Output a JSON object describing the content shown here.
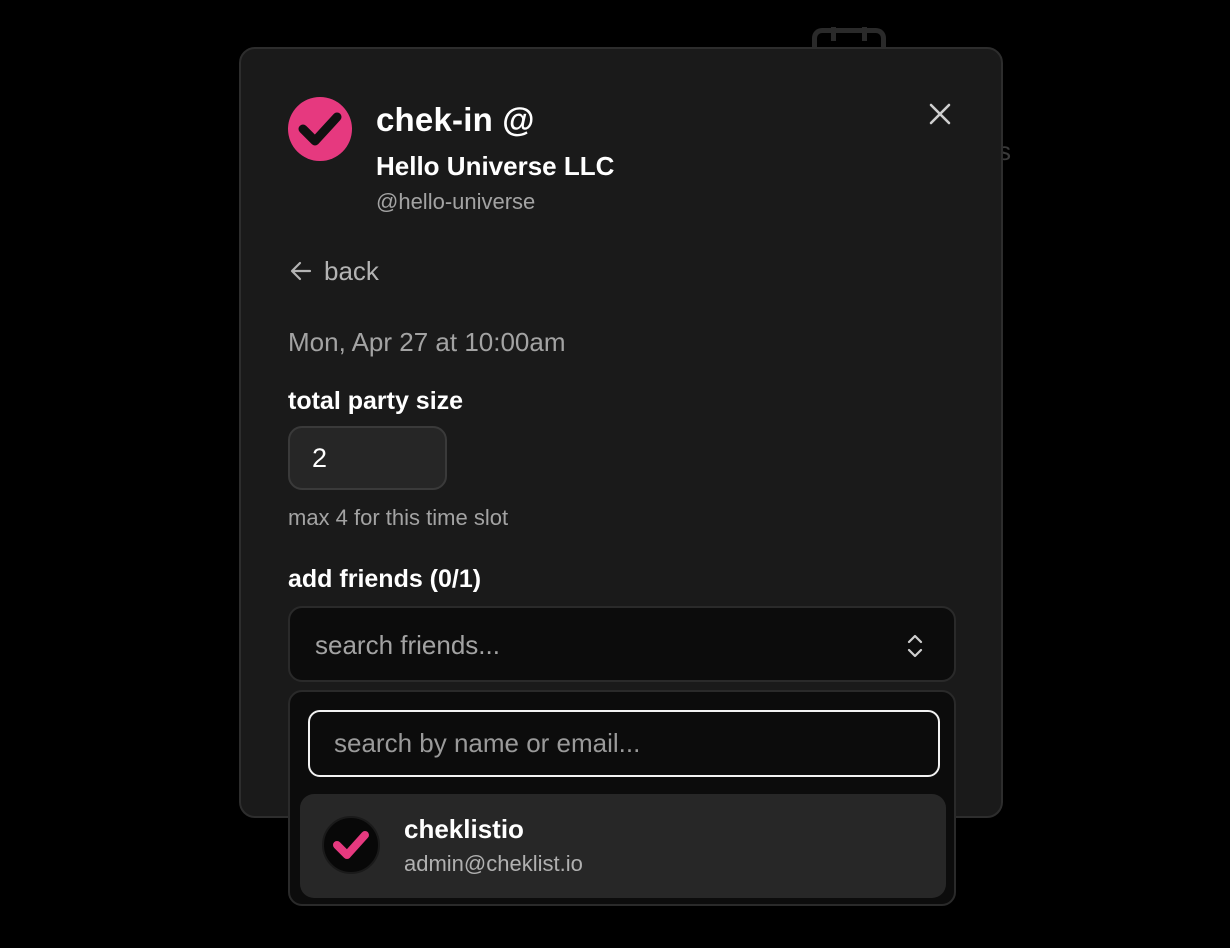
{
  "header": {
    "title": "chek-in @",
    "org_name": "Hello Universe LLC",
    "org_handle": "@hello-universe"
  },
  "nav": {
    "back_label": "back"
  },
  "booking": {
    "datetime": "Mon, Apr 27 at 10:00am"
  },
  "party": {
    "label": "total party size",
    "value": "2",
    "hint": "max 4 for this time slot"
  },
  "friends": {
    "label": "add friends (0/1)",
    "select_placeholder": "search friends...",
    "search_placeholder": "search by name or email...",
    "options": [
      {
        "name": "cheklistio",
        "email": "admin@cheklist.io"
      }
    ]
  },
  "icons": {
    "logo": "checkmark-logo-icon",
    "close": "close-icon",
    "back": "arrow-left-icon",
    "select": "chevron-up-down-icon",
    "avatar": "checkmark-avatar-icon"
  },
  "colors": {
    "accent": "#e6397f",
    "background": "#000000",
    "modal": "#1a1a1a",
    "muted_text": "#a3a3a3"
  }
}
